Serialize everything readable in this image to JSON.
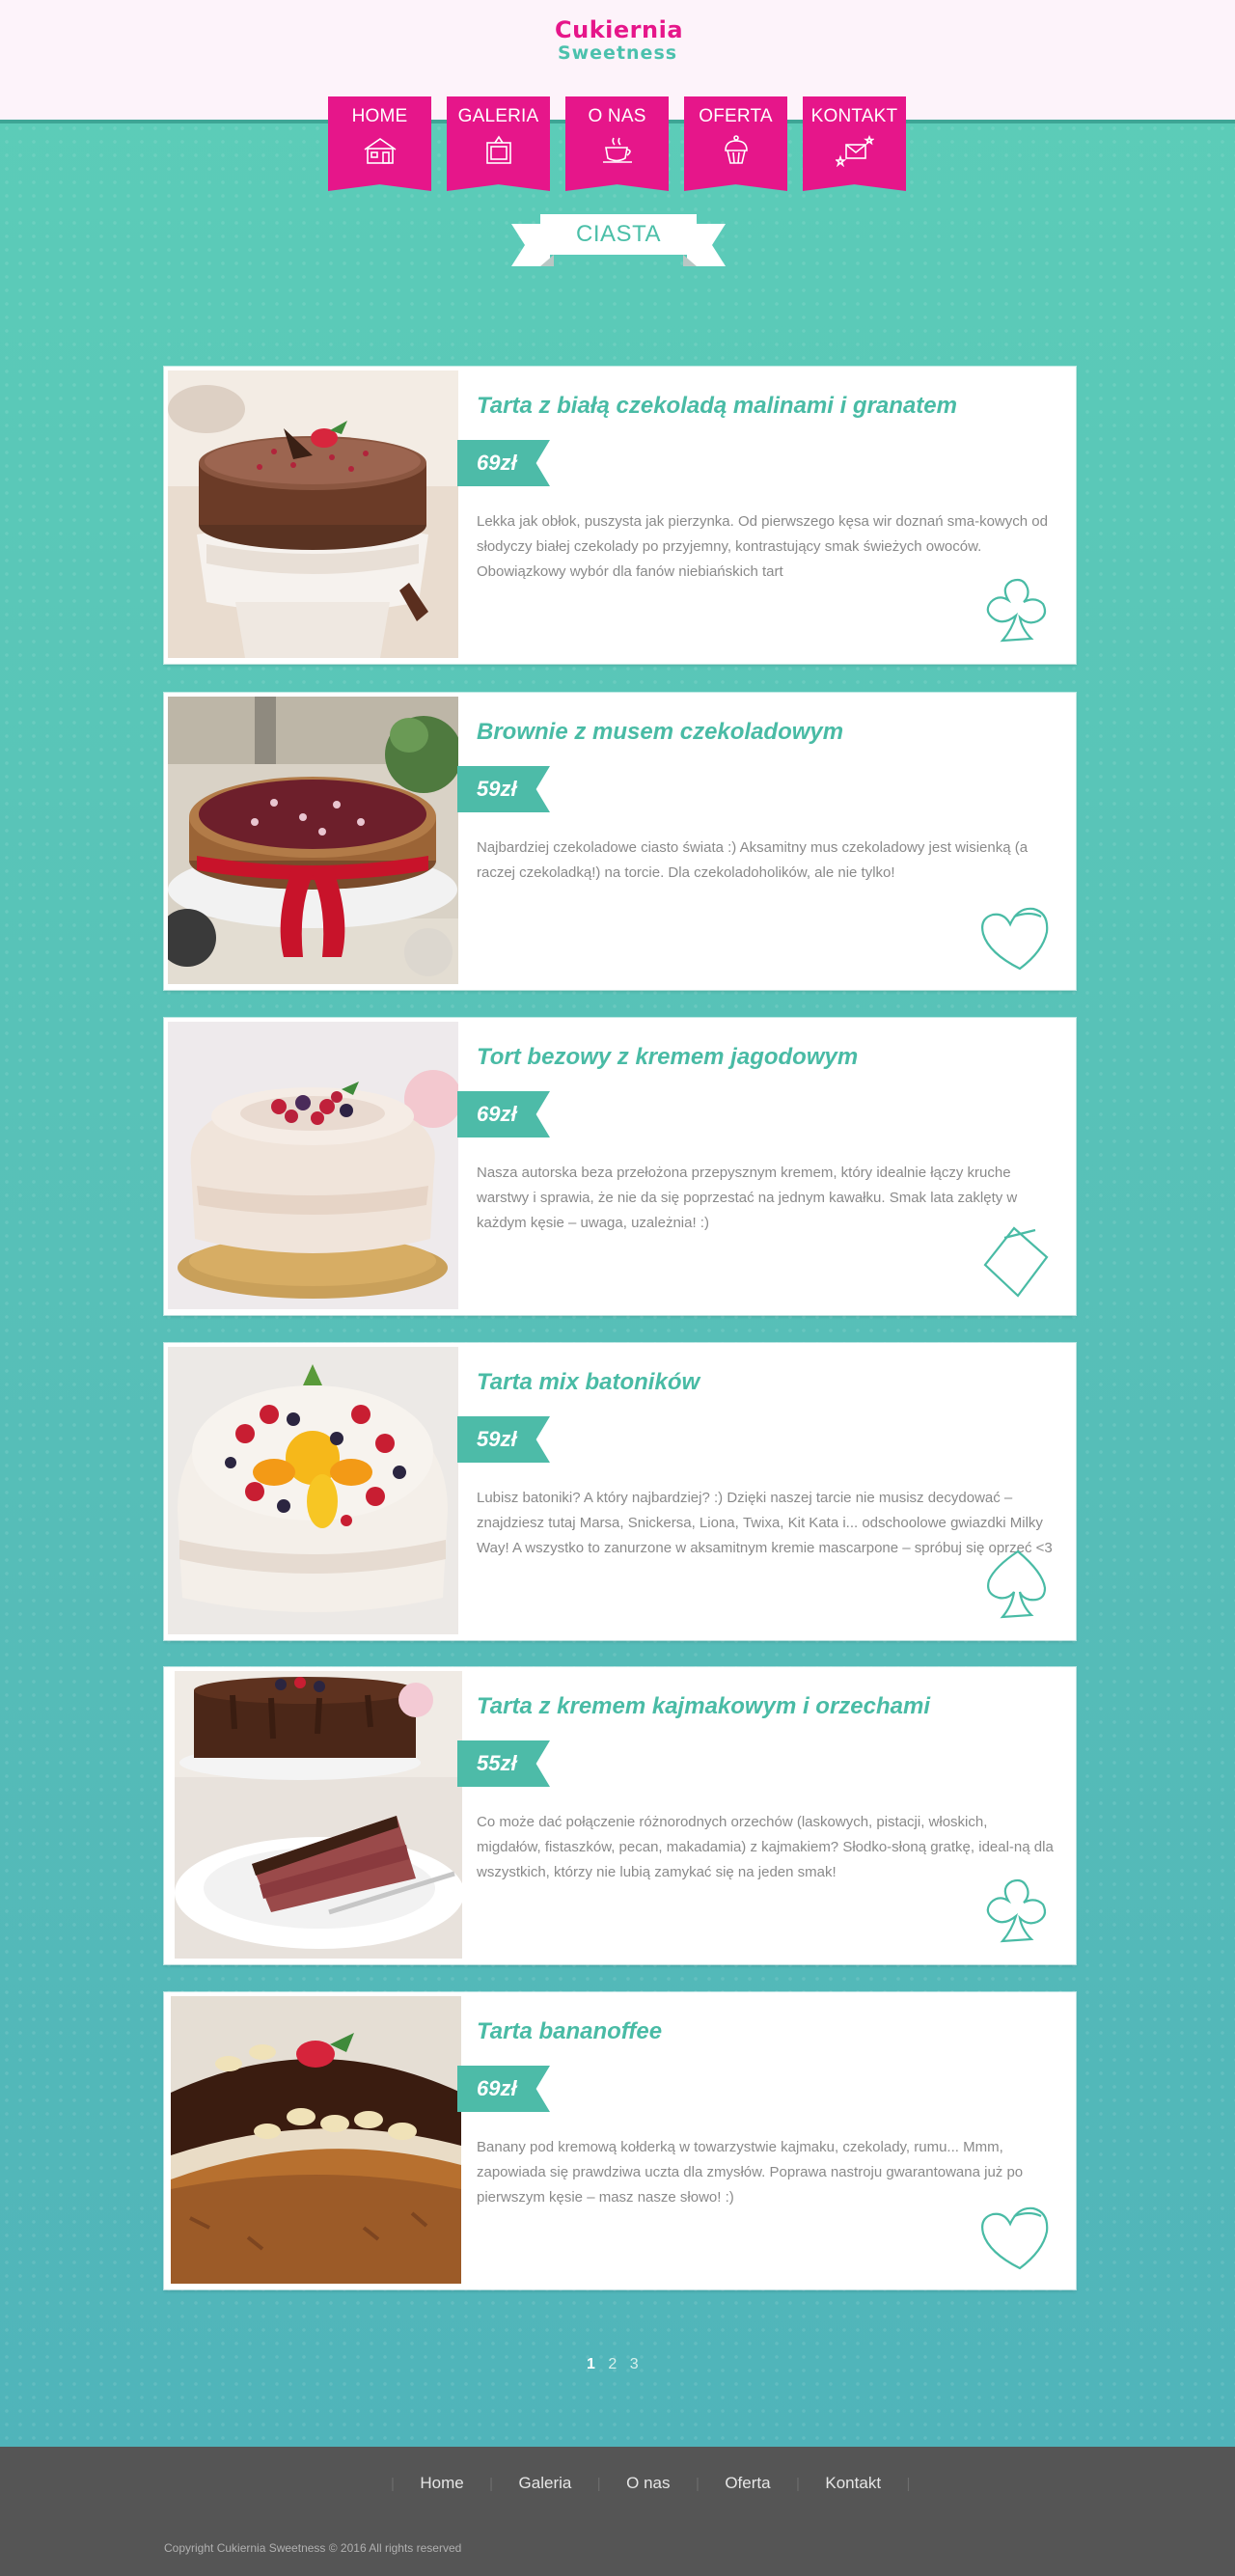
{
  "logo": {
    "line1": "Cukiernia",
    "line2": "Sweetness"
  },
  "nav": [
    {
      "label": "HOME",
      "icon": "house-icon"
    },
    {
      "label": "GALERIA",
      "icon": "picture-frame-icon"
    },
    {
      "label": "O NAS",
      "icon": "coffee-cup-icon"
    },
    {
      "label": "OFERTA",
      "icon": "cupcake-icon"
    },
    {
      "label": "KONTAKT",
      "icon": "envelope-stars-icon"
    }
  ],
  "section_title": "CIASTA",
  "colors": {
    "accent_pink": "#e6168a",
    "accent_teal": "#4dbba8",
    "background": "#5bc3b2",
    "footer": "#555555"
  },
  "products": [
    {
      "title": "Tarta z białą czekoladą malinami i granatem",
      "price": "69zł",
      "description": "Lekka jak obłok, puszysta jak pierzynka. Od pierwszego kęsa wir doznań sma-kowych od słodyczy białej czekolady po przyjemny, kontrastujący smak świeżych owoców. Obowiązkowy wybór dla fanów niebiańskich tart",
      "suit_icon": "club-icon"
    },
    {
      "title": "Brownie z musem czekoladowym",
      "price": "59zł",
      "description": "Najbardziej czekoladowe ciasto świata :) Aksamitny mus czekoladowy jest wisienką (a raczej czekoladką!) na torcie. Dla czekoladoholików, ale nie tylko!",
      "suit_icon": "heart-icon"
    },
    {
      "title": "Tort bezowy z kremem jagodowym",
      "price": "69zł",
      "description": "Nasza autorska beza przełożona przepysznym kremem, który idealnie łączy kruche warstwy i sprawia, że nie da się poprzestać na jednym kawałku. Smak lata zaklęty w każdym kęsie – uwaga, uzależnia! :)",
      "suit_icon": "diamond-icon"
    },
    {
      "title": "Tarta mix batoników",
      "price": "59zł",
      "description": "Lubisz batoniki? A który najbardziej? :) Dzięki naszej tarcie nie musisz decydować – znajdziesz tutaj Marsa, Snickersa, Lionа, Twixa, Kit Kata i... odschoolowe gwiazdki Milky Way! A wszystko to zanurzone w aksamitnym kremie mascarpone – spróbuj się oprzeć <3",
      "suit_icon": "spade-icon"
    },
    {
      "title": "Tarta z kremem kajmakowym i orzechami",
      "price": "55zł",
      "description": "Co może dać połączenie różnorodnych orzechów (laskowych, pistacji, włoskich, migdałów, fistaszków, pecan, makadamia) z kajmakiem? Słodko-słoną gratkę, ideal-ną dla wszystkich, którzy nie lubią zamykać się na jeden smak!",
      "suit_icon": "club-icon"
    },
    {
      "title": "Tarta bananoffee",
      "price": "69zł",
      "description": "Banany pod kremową kołderką w towarzystwie kajmaku, czekolady, rumu... Mmm, zapowiada się prawdziwa uczta dla zmysłów. Poprawa nastroju gwarantowana już po\npierwszym kęsie – masz nasze słowo! :)",
      "suit_icon": "heart-icon"
    }
  ],
  "pagination": [
    "1",
    "2",
    "3"
  ],
  "footer": {
    "links": [
      "Home",
      "Galeria",
      "O nas",
      "Oferta",
      "Kontakt"
    ],
    "copyright": "Copyright Cukiernia Sweetness © 2016 All rights reserved"
  }
}
